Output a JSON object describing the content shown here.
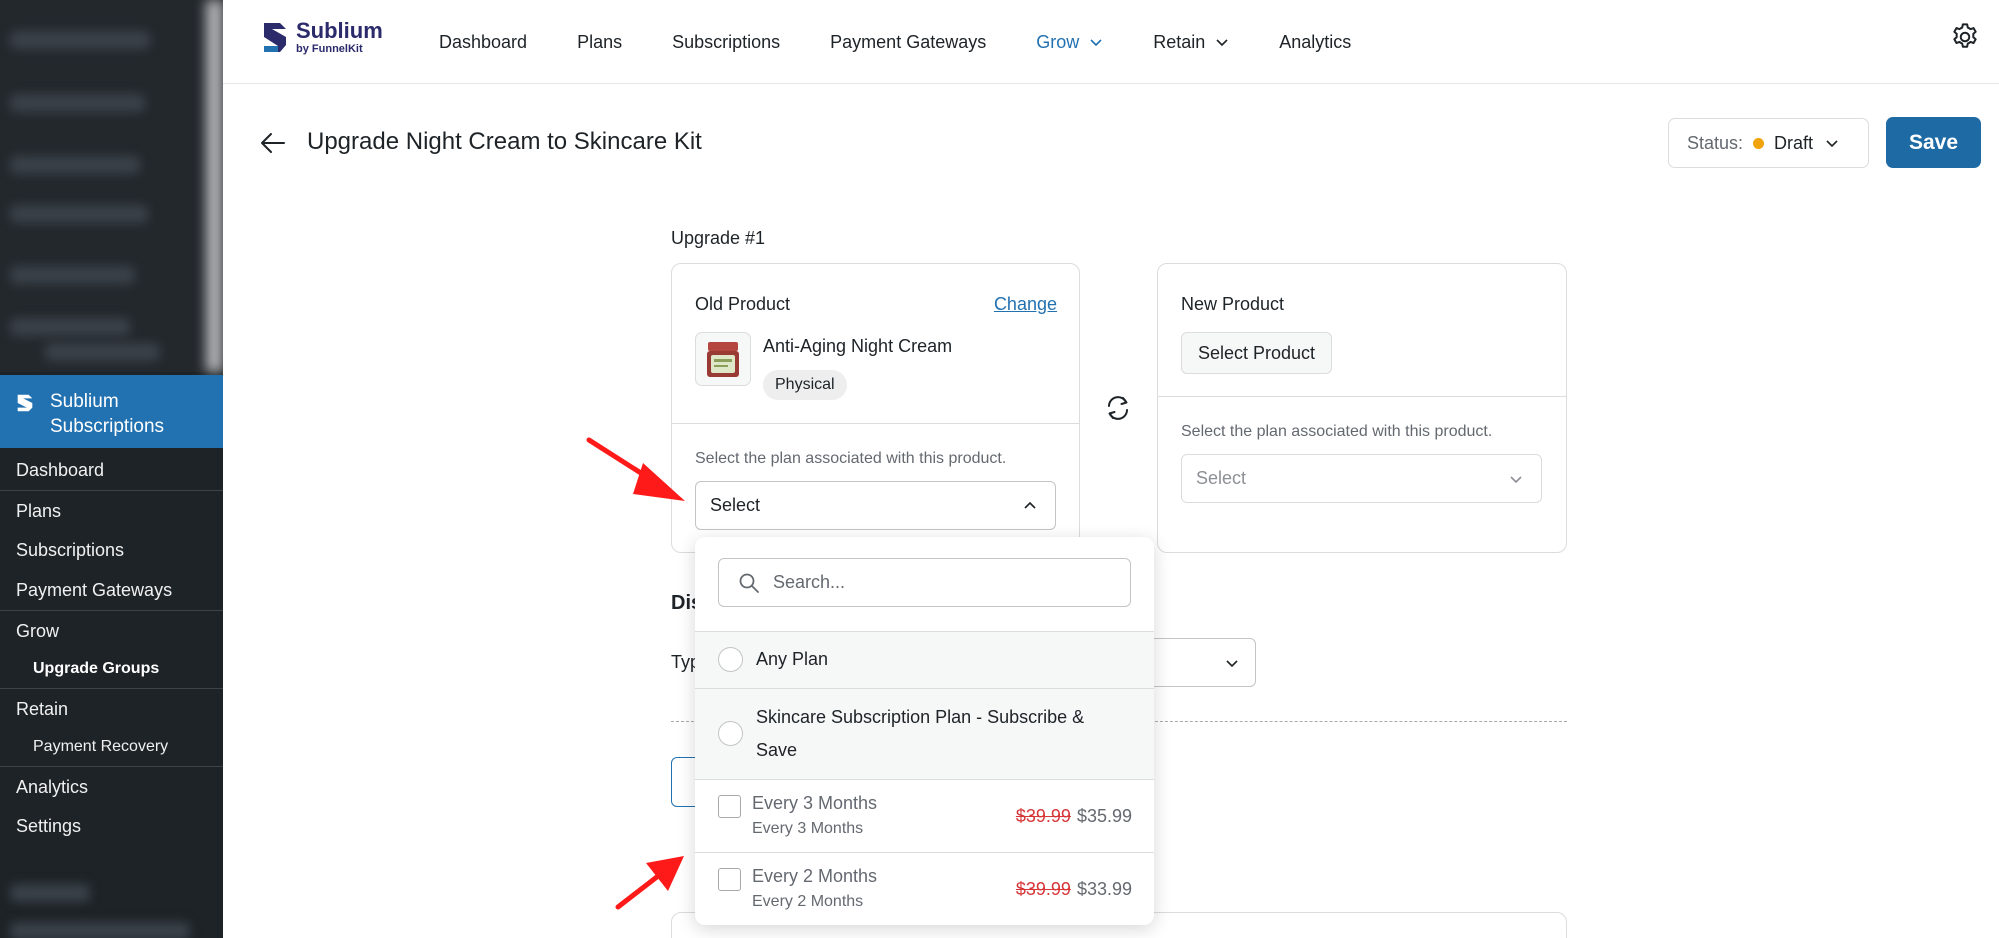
{
  "sidebar": {
    "active_label": "Sublium Subscriptions",
    "items": [
      {
        "label": "Dashboard",
        "type": "item"
      },
      {
        "label": "Plans",
        "type": "item"
      },
      {
        "label": "Subscriptions",
        "type": "item"
      },
      {
        "label": "Payment Gateways",
        "type": "item"
      },
      {
        "label": "Grow",
        "type": "item"
      },
      {
        "label": "Upgrade Groups",
        "type": "sub-bold"
      },
      {
        "label": "Retain",
        "type": "item"
      },
      {
        "label": "Payment Recovery",
        "type": "sub"
      },
      {
        "label": "Analytics",
        "type": "item"
      },
      {
        "label": "Settings",
        "type": "item"
      }
    ]
  },
  "brand": {
    "name": "Sublium",
    "by": "by",
    "company": "FunnelKit",
    "color": "#2b2a6b",
    "accent": "#2271b1"
  },
  "nav": {
    "items": [
      "Dashboard",
      "Plans",
      "Subscriptions",
      "Payment Gateways",
      "Grow",
      "Retain",
      "Analytics"
    ],
    "active": "Grow"
  },
  "header": {
    "title": "Upgrade Night Cream to Skincare Kit",
    "status_label": "Status:",
    "status_value": "Draft",
    "status_color": "#f0a30a",
    "save_label": "Save"
  },
  "upgrade": {
    "label": "Upgrade #1",
    "old": {
      "heading": "Old Product",
      "change_label": "Change",
      "product_name": "Anti-Aging Night Cream",
      "badge": "Physical",
      "helper": "Select the plan associated with this product.",
      "select_value": "Select"
    },
    "new": {
      "heading": "New Product",
      "select_product_label": "Select Product",
      "helper": "Select the plan associated with this product.",
      "select_placeholder": "Select"
    }
  },
  "background": {
    "section_fragment": "Dis",
    "type_fragment": "Typ"
  },
  "dropdown": {
    "search_placeholder": "Search...",
    "any_plan": "Any Plan",
    "plan_group": "Skincare Subscription Plan - Subscribe & Save",
    "options": [
      {
        "title": "Every 3 Months",
        "subtitle": "Every 3 Months",
        "old_price": "$39.99",
        "new_price": "$35.99"
      },
      {
        "title": "Every 2 Months",
        "subtitle": "Every 2 Months",
        "old_price": "$39.99",
        "new_price": "$33.99"
      }
    ]
  },
  "icons": [
    "back-arrow-icon",
    "gear-icon",
    "chevron-down-icon",
    "chevron-up-icon",
    "swap-icon",
    "search-icon"
  ]
}
